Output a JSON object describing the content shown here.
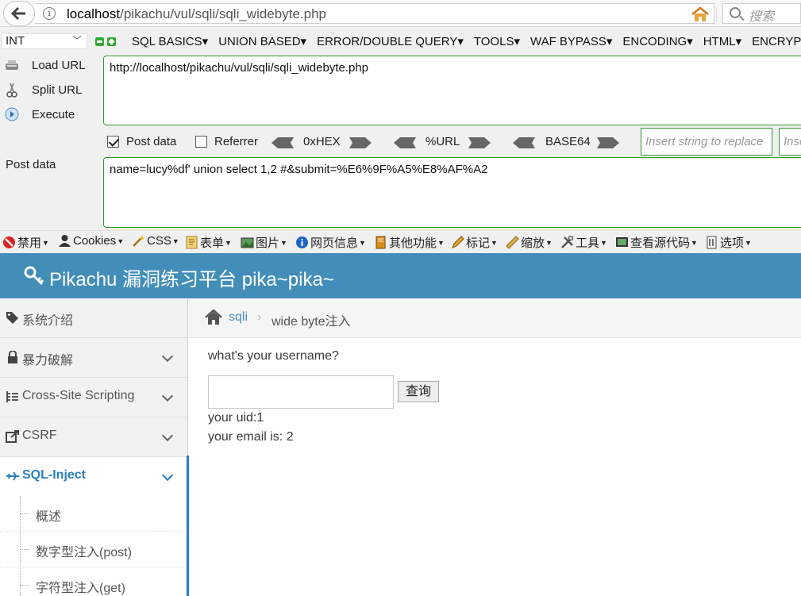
{
  "browser": {
    "url_host": "localhost",
    "url_path": "/pikachu/vul/sqli/sqli_widebyte.php",
    "search_placeholder": "搜索"
  },
  "hackbar": {
    "type_select": "INT",
    "menu": [
      "SQL BASICS",
      "UNION BASED",
      "ERROR/DOUBLE QUERY",
      "TOOLS",
      "WAF BYPASS",
      "ENCODING",
      "HTML",
      "ENCRYPTIO"
    ],
    "load_url": "Load URL",
    "split_url": "Split URL",
    "execute": "Execute",
    "url_value": "http://localhost/pikachu/vul/sqli/sqli_widebyte.php",
    "post_data_checkbox": "Post data",
    "referrer_checkbox": "Referrer",
    "hex_label": "0xHEX",
    "url_enc_label": "%URL",
    "base64_label": "BASE64",
    "replace_placeholder": "Insert string to replace",
    "replace_with_placeholder": "Insert",
    "post_data_label": "Post data",
    "post_data_value": "name=lucy%df' union select 1,2 #&submit=%E6%9F%A5%E8%AF%A2"
  },
  "toolbar": {
    "items": [
      "禁用",
      "Cookies",
      "CSS",
      "表单",
      "图片",
      "网页信息",
      "其他功能",
      "标记",
      "缩放",
      "工具",
      "查看源代码",
      "选项"
    ]
  },
  "page": {
    "header_title": "Pikachu 漏洞练习平台 pika~pika~",
    "sidebar": {
      "items": [
        "系统介绍",
        "暴力破解",
        "Cross-Site Scripting",
        "CSRF",
        "SQL-Inject"
      ],
      "sub_items": [
        "概述",
        "数字型注入(post)",
        "字符型注入(get)"
      ]
    },
    "breadcrumb": {
      "link": "sqli",
      "current": "wide byte注入"
    },
    "form": {
      "question": "what's your username?",
      "input_value": "",
      "button": "查询"
    },
    "result": {
      "uid": "your uid:1",
      "email": "your email is: 2"
    }
  },
  "colors": {
    "header_bg": "#438eb9",
    "link": "#2b7dbc",
    "hackbar_border": "#2f9a2f"
  }
}
